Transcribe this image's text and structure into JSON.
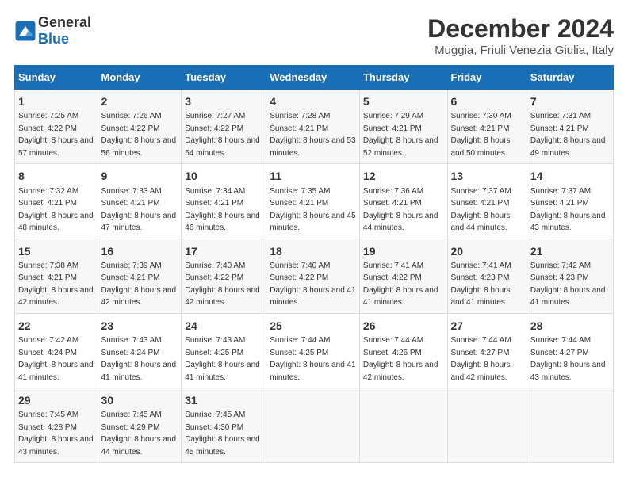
{
  "logo": {
    "general": "General",
    "blue": "Blue"
  },
  "title": "December 2024",
  "subtitle": "Muggia, Friuli Venezia Giulia, Italy",
  "days_header": [
    "Sunday",
    "Monday",
    "Tuesday",
    "Wednesday",
    "Thursday",
    "Friday",
    "Saturday"
  ],
  "weeks": [
    [
      {
        "day": "1",
        "sunrise": "7:25 AM",
        "sunset": "4:22 PM",
        "daylight": "8 hours and 57 minutes."
      },
      {
        "day": "2",
        "sunrise": "7:26 AM",
        "sunset": "4:22 PM",
        "daylight": "8 hours and 56 minutes."
      },
      {
        "day": "3",
        "sunrise": "7:27 AM",
        "sunset": "4:22 PM",
        "daylight": "8 hours and 54 minutes."
      },
      {
        "day": "4",
        "sunrise": "7:28 AM",
        "sunset": "4:21 PM",
        "daylight": "8 hours and 53 minutes."
      },
      {
        "day": "5",
        "sunrise": "7:29 AM",
        "sunset": "4:21 PM",
        "daylight": "8 hours and 52 minutes."
      },
      {
        "day": "6",
        "sunrise": "7:30 AM",
        "sunset": "4:21 PM",
        "daylight": "8 hours and 50 minutes."
      },
      {
        "day": "7",
        "sunrise": "7:31 AM",
        "sunset": "4:21 PM",
        "daylight": "8 hours and 49 minutes."
      }
    ],
    [
      {
        "day": "8",
        "sunrise": "7:32 AM",
        "sunset": "4:21 PM",
        "daylight": "8 hours and 48 minutes."
      },
      {
        "day": "9",
        "sunrise": "7:33 AM",
        "sunset": "4:21 PM",
        "daylight": "8 hours and 47 minutes."
      },
      {
        "day": "10",
        "sunrise": "7:34 AM",
        "sunset": "4:21 PM",
        "daylight": "8 hours and 46 minutes."
      },
      {
        "day": "11",
        "sunrise": "7:35 AM",
        "sunset": "4:21 PM",
        "daylight": "8 hours and 45 minutes."
      },
      {
        "day": "12",
        "sunrise": "7:36 AM",
        "sunset": "4:21 PM",
        "daylight": "8 hours and 44 minutes."
      },
      {
        "day": "13",
        "sunrise": "7:37 AM",
        "sunset": "4:21 PM",
        "daylight": "8 hours and 44 minutes."
      },
      {
        "day": "14",
        "sunrise": "7:37 AM",
        "sunset": "4:21 PM",
        "daylight": "8 hours and 43 minutes."
      }
    ],
    [
      {
        "day": "15",
        "sunrise": "7:38 AM",
        "sunset": "4:21 PM",
        "daylight": "8 hours and 42 minutes."
      },
      {
        "day": "16",
        "sunrise": "7:39 AM",
        "sunset": "4:21 PM",
        "daylight": "8 hours and 42 minutes."
      },
      {
        "day": "17",
        "sunrise": "7:40 AM",
        "sunset": "4:22 PM",
        "daylight": "8 hours and 42 minutes."
      },
      {
        "day": "18",
        "sunrise": "7:40 AM",
        "sunset": "4:22 PM",
        "daylight": "8 hours and 41 minutes."
      },
      {
        "day": "19",
        "sunrise": "7:41 AM",
        "sunset": "4:22 PM",
        "daylight": "8 hours and 41 minutes."
      },
      {
        "day": "20",
        "sunrise": "7:41 AM",
        "sunset": "4:23 PM",
        "daylight": "8 hours and 41 minutes."
      },
      {
        "day": "21",
        "sunrise": "7:42 AM",
        "sunset": "4:23 PM",
        "daylight": "8 hours and 41 minutes."
      }
    ],
    [
      {
        "day": "22",
        "sunrise": "7:42 AM",
        "sunset": "4:24 PM",
        "daylight": "8 hours and 41 minutes."
      },
      {
        "day": "23",
        "sunrise": "7:43 AM",
        "sunset": "4:24 PM",
        "daylight": "8 hours and 41 minutes."
      },
      {
        "day": "24",
        "sunrise": "7:43 AM",
        "sunset": "4:25 PM",
        "daylight": "8 hours and 41 minutes."
      },
      {
        "day": "25",
        "sunrise": "7:44 AM",
        "sunset": "4:25 PM",
        "daylight": "8 hours and 41 minutes."
      },
      {
        "day": "26",
        "sunrise": "7:44 AM",
        "sunset": "4:26 PM",
        "daylight": "8 hours and 42 minutes."
      },
      {
        "day": "27",
        "sunrise": "7:44 AM",
        "sunset": "4:27 PM",
        "daylight": "8 hours and 42 minutes."
      },
      {
        "day": "28",
        "sunrise": "7:44 AM",
        "sunset": "4:27 PM",
        "daylight": "8 hours and 43 minutes."
      }
    ],
    [
      {
        "day": "29",
        "sunrise": "7:45 AM",
        "sunset": "4:28 PM",
        "daylight": "8 hours and 43 minutes."
      },
      {
        "day": "30",
        "sunrise": "7:45 AM",
        "sunset": "4:29 PM",
        "daylight": "8 hours and 44 minutes."
      },
      {
        "day": "31",
        "sunrise": "7:45 AM",
        "sunset": "4:30 PM",
        "daylight": "8 hours and 45 minutes."
      },
      null,
      null,
      null,
      null
    ]
  ],
  "labels": {
    "sunrise": "Sunrise:",
    "sunset": "Sunset:",
    "daylight": "Daylight:"
  }
}
